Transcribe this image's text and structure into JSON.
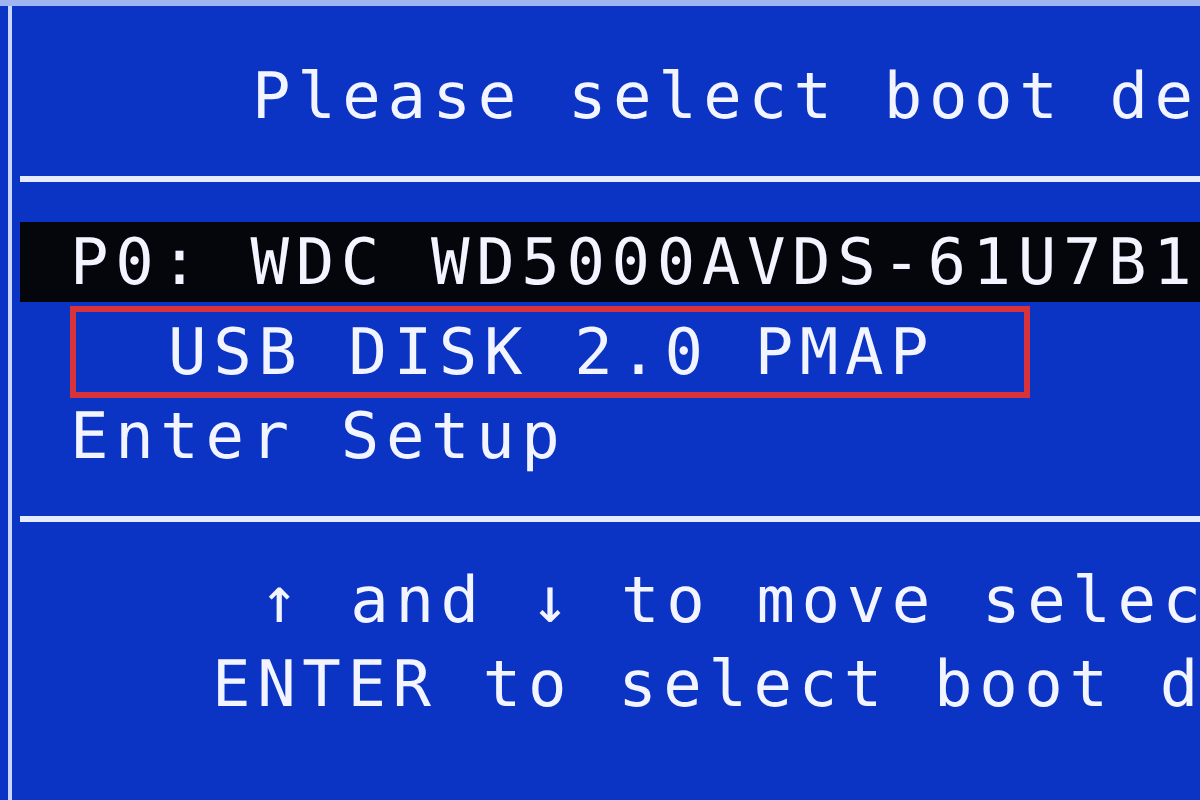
{
  "title": "Please select boot de",
  "items": [
    {
      "label": "P0: WDC WD5000AVDS-61U7B1",
      "selected": true,
      "marked": false
    },
    {
      "label": "USB DISK 2.0 PMAP",
      "selected": false,
      "marked": true
    },
    {
      "label": "Enter Setup",
      "selected": false,
      "marked": false
    }
  ],
  "help": [
    "↑ and ↓ to move selec",
    "ENTER to select boot d"
  ]
}
